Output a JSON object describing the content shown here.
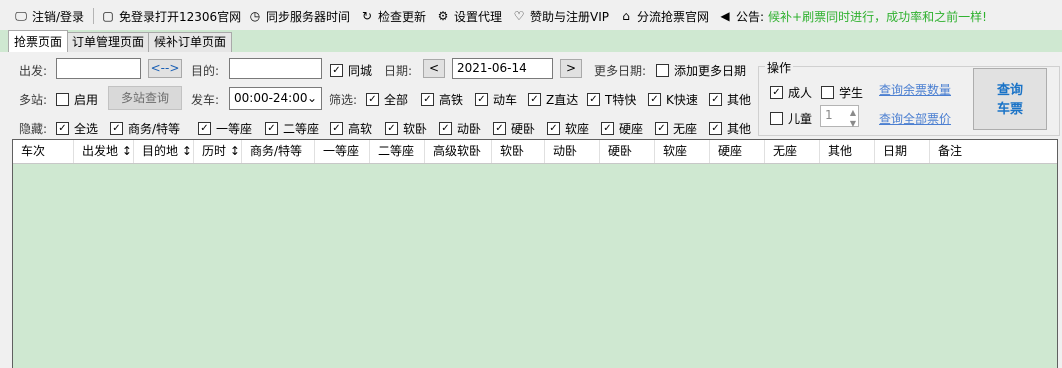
{
  "toolbar": {
    "items": [
      {
        "icon": "monitor-icon",
        "glyph": "🖵",
        "label": "注销/登录"
      },
      {
        "icon": "window-icon",
        "glyph": "▢",
        "label": "免登录打开12306官网"
      },
      {
        "icon": "clock-icon",
        "glyph": "◷",
        "label": "同步服务器时间"
      },
      {
        "icon": "refresh-icon",
        "glyph": "↻",
        "label": "检查更新"
      },
      {
        "icon": "gear-icon",
        "glyph": "⚙",
        "label": "设置代理"
      },
      {
        "icon": "heart-icon",
        "glyph": "♡",
        "label": "赞助与注册VIP"
      },
      {
        "icon": "home-icon",
        "glyph": "⌂",
        "label": "分流抢票官网"
      },
      {
        "icon": "speaker-icon",
        "glyph": "◀",
        "label": "公告:"
      }
    ],
    "announcement": "候补+刷票同时进行，成功率和之前一样!"
  },
  "tabs": [
    {
      "label": "抢票页面",
      "active": true
    },
    {
      "label": "订单管理页面",
      "active": false
    },
    {
      "label": "候补订单页面",
      "active": false
    }
  ],
  "search": {
    "from_label": "出发:",
    "from_value": "",
    "swap_label": "<-->",
    "to_label": "目的:",
    "to_value": "",
    "same_city_label": "同城",
    "same_city_checked": true,
    "date_label": "日期:",
    "prev_label": "<",
    "date_value": "2021-06-14",
    "next_label": ">",
    "more_dates_label": "更多日期:",
    "add_dates_label": "添加更多日期",
    "add_dates_checked": false,
    "multi_station_label": "多站:",
    "enable_label": "启用",
    "enable_checked": false,
    "multi_query_label": "多站查询",
    "depart_label": "发车:",
    "depart_value": "00:00-24:00",
    "filter_label": "筛选:",
    "hide_label": "隐藏:"
  },
  "filters": [
    {
      "label": "全部",
      "checked": true
    },
    {
      "label": "高铁",
      "checked": true
    },
    {
      "label": "动车",
      "checked": true
    },
    {
      "label": "Z直达",
      "checked": true
    },
    {
      "label": "T特快",
      "checked": true
    },
    {
      "label": "K快速",
      "checked": true
    },
    {
      "label": "其他",
      "checked": true
    }
  ],
  "hide_options": [
    {
      "label": "全选",
      "checked": true
    },
    {
      "label": "商务/特等",
      "checked": true
    },
    {
      "label": "一等座",
      "checked": true
    },
    {
      "label": "二等座",
      "checked": true
    },
    {
      "label": "高软",
      "checked": true
    },
    {
      "label": "软卧",
      "checked": true
    },
    {
      "label": "动卧",
      "checked": true
    },
    {
      "label": "硬卧",
      "checked": true
    },
    {
      "label": "软座",
      "checked": true
    },
    {
      "label": "硬座",
      "checked": true
    },
    {
      "label": "无座",
      "checked": true
    },
    {
      "label": "其他",
      "checked": true
    }
  ],
  "operations": {
    "title": "操作",
    "adult_label": "成人",
    "adult_checked": true,
    "student_label": "学生",
    "student_checked": false,
    "child_label": "儿童",
    "child_checked": false,
    "child_count": "1",
    "remaining_link": "查询余票数量",
    "all_prices_link": "查询全部票价",
    "query_line1": "查询",
    "query_line2": "车票"
  },
  "grid": {
    "columns": [
      "车次",
      "出发地 ↕",
      "目的地 ↕",
      "历时 ↕",
      "商务/特等",
      "一等座",
      "二等座",
      "高级软卧",
      "软卧",
      "动卧",
      "硬卧",
      "软座",
      "硬座",
      "无座",
      "其他",
      "日期",
      "备注"
    ]
  }
}
